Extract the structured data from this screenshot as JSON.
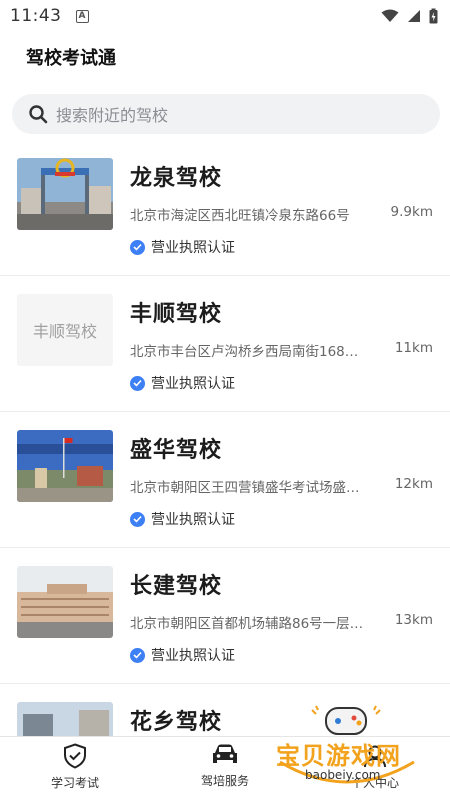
{
  "status": {
    "time": "11:43",
    "indicator": "A"
  },
  "header": {
    "title": "驾校考试通"
  },
  "search": {
    "placeholder": "搜索附近的驾校"
  },
  "schools": [
    {
      "name": "龙泉驾校",
      "address": "北京市海淀区西北旺镇冷泉东路66号",
      "distance": "9.9km",
      "badge": "营业执照认证",
      "thumb_text": ""
    },
    {
      "name": "丰顺驾校",
      "address": "北京市丰台区卢沟桥乡西局南街168…",
      "distance": "11km",
      "badge": "营业执照认证",
      "thumb_text": "丰顺驾校"
    },
    {
      "name": "盛华驾校",
      "address": "北京市朝阳区王四营镇盛华考试场盛…",
      "distance": "12km",
      "badge": "营业执照认证",
      "thumb_text": ""
    },
    {
      "name": "长建驾校",
      "address": "北京市朝阳区首都机场辅路86号一层…",
      "distance": "13km",
      "badge": "营业执照认证",
      "thumb_text": ""
    },
    {
      "name": "花乡驾校",
      "address": "",
      "distance": "",
      "badge": "",
      "thumb_text": ""
    }
  ],
  "tabs": [
    {
      "label": "学习考试",
      "icon": "shield-check-icon"
    },
    {
      "label": "驾培服务",
      "icon": "car-icon"
    },
    {
      "label": "个人中心",
      "icon": "user-icon"
    }
  ],
  "watermark": {
    "text": "宝贝游戏网",
    "url": "baobeiy.com"
  },
  "colors": {
    "accent": "#3d7ff5",
    "search_bg": "#f1f2f4",
    "watermark": "#f2a21c"
  }
}
